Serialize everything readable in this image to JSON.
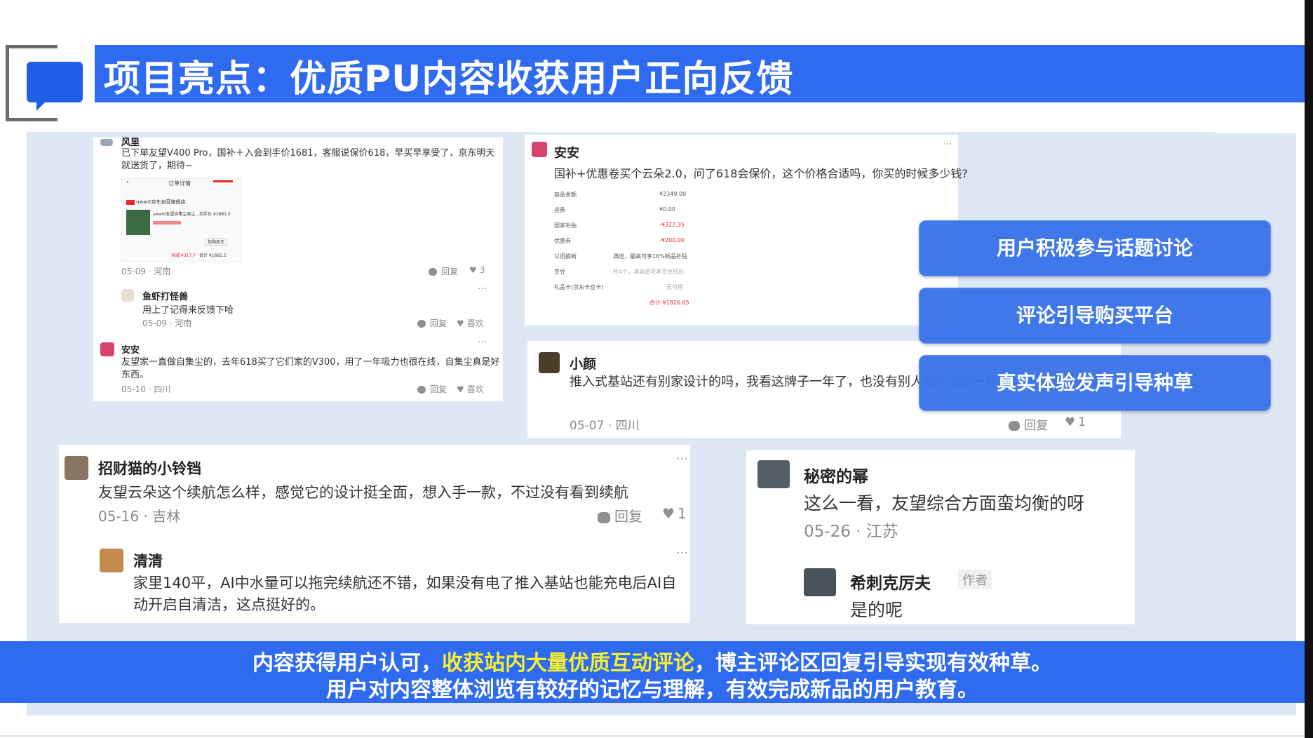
{
  "title": "项目亮点：优质PU内容收获用户正向反馈",
  "cards": {
    "top_left": {
      "c1": {
        "name": "风里",
        "text": "已下单友望V400 Pro，国补＋入会到手价1681，客服说保价618，早买早享受了，京东明天就送货了，期待~",
        "date": "05-09",
        "loc": "河南",
        "reply": "回复",
        "likes": "3"
      },
      "order": {
        "header": "订单详情",
        "store": "uwant京东自营旗舰店",
        "product": "uwant友望自集尘吸尘…",
        "price": "到手价 ¥1681.5",
        "label": "加购商车",
        "saved": "共减 ¥317.7",
        "total": "合计 ¥1681.5"
      },
      "c2": {
        "name": "鱼虾打怪兽",
        "text": "用上了记得来反馈下哈",
        "date": "05-09",
        "loc": "河南",
        "reply": "回复",
        "likes": "喜欢"
      },
      "c3": {
        "name": "安安",
        "text": "友望家一直做自集尘的，去年618买了它们家的V300，用了一年吸力也很在线，自集尘真是好东西。",
        "date": "05-10",
        "loc": "四川",
        "reply": "回复",
        "likes": "喜欢"
      }
    },
    "top_mid": {
      "name": "安安",
      "text": "国补+优惠卷买个云朵2.0，问了618会保价，这个价格合适吗，你买的时候多少钱?",
      "rows": [
        {
          "k": "商品金额",
          "v": "¥2349.00"
        },
        {
          "k": "运费",
          "v": "¥0.00"
        },
        {
          "k": "国家补贴",
          "v": "-¥322.35"
        },
        {
          "k": "优惠券",
          "v": "-¥200.00"
        },
        {
          "k": "以旧换新",
          "v": "满送，最高可享16%新品补贴"
        },
        {
          "k": "京豆",
          "v": "共4个，满商品可享京豆抵扣"
        },
        {
          "k": "礼品卡(京东卡应卡)",
          "v": "无可用"
        },
        {
          "k": "",
          "v": "合计 ¥1826.65"
        }
      ]
    },
    "mid_right": {
      "name": "小颜",
      "text": "推入式基站还有别家设计的吗，我看这牌子一年了，也没有别人和它做的一样的，还是设计很难吗",
      "date": "05-07",
      "loc": "四川",
      "reply": "回复",
      "likes": "1"
    },
    "bottom_left": {
      "c1": {
        "name": "招财猫的小铃铛",
        "text": "友望云朵这个续航怎么样，感觉它的设计挺全面，想入手一款，不过没有看到续航",
        "date": "05-16",
        "loc": "吉林",
        "reply": "回复",
        "likes": "1"
      },
      "c2": {
        "name": "清清",
        "text": "家里140平，AI中水量可以拖完续航还不错，如果没有电了推入基站也能充电后AI自动开启自清洁，这点挺好的。"
      }
    },
    "bottom_right": {
      "c1": {
        "name": "秘密的幂",
        "text": "这么一看，友望综合方面蛮均衡的呀",
        "date": "05-26",
        "loc": "江苏"
      },
      "c2": {
        "name": "希刺克厉夫",
        "badge": "作者",
        "text": "是的呢"
      }
    }
  },
  "callouts": [
    "用户积极参与话题讨论",
    "评论引导购买平台",
    "真实体验发声引导种草"
  ],
  "summary": {
    "line1_a": "内容获得用户认可，",
    "line1_hl": "收获站内大量优质互动评论",
    "line1_b": "，博主评论区回复引导实现有效种草。",
    "line2": "用户对内容整体浏览有较好的记忆与理解，有效完成新品的用户教育。"
  },
  "colors": {
    "brand_blue": "#2f6bf0",
    "panel_bg": "#dee7f4",
    "highlight": "#f5ef32"
  }
}
